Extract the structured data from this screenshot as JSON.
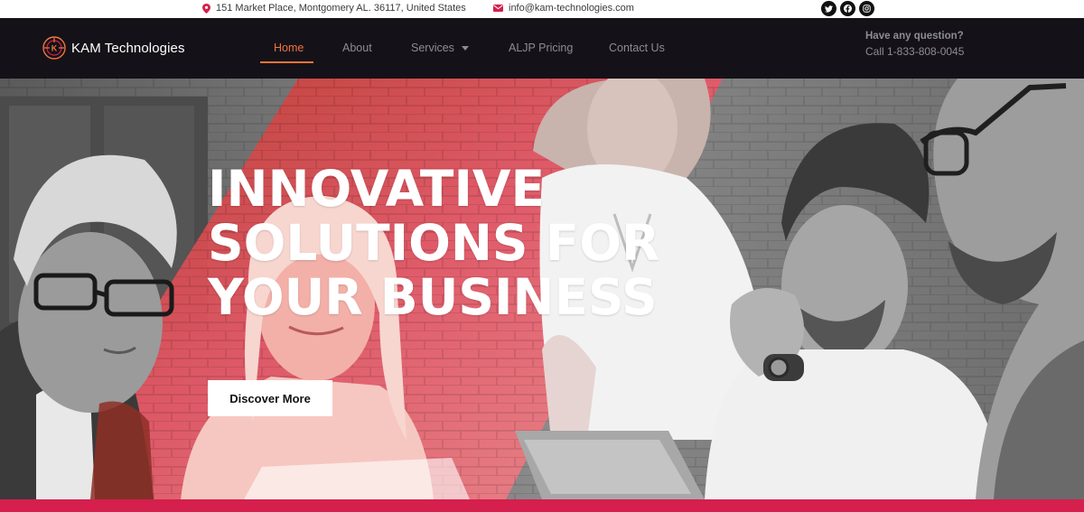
{
  "topbar": {
    "address": "151 Market Place, Montgomery AL. 36117, United States",
    "email": "info@kam-technologies.com",
    "socials": [
      "twitter-icon",
      "facebook-icon",
      "instagram-icon"
    ]
  },
  "navbar": {
    "logo_text": "KAM Technologies",
    "items": [
      {
        "label": "Home",
        "active": true
      },
      {
        "label": "About",
        "active": false
      },
      {
        "label": "Services",
        "active": false,
        "has_dropdown": true
      },
      {
        "label": "ALJP Pricing",
        "active": false
      },
      {
        "label": "Contact Us",
        "active": false
      }
    ],
    "question_title": "Have any question?",
    "phone": "Call 1-833-808-0045"
  },
  "hero": {
    "title_lines": [
      "INNOVATIVE",
      "SOLUTIONS FOR",
      "YOUR BUSINESS"
    ],
    "cta_label": "Discover More"
  },
  "colors": {
    "nav_background": "#141218",
    "accent_orange": "#f0743e",
    "accent_red": "#d51f4c",
    "hero_overlay": "#e8465a"
  }
}
